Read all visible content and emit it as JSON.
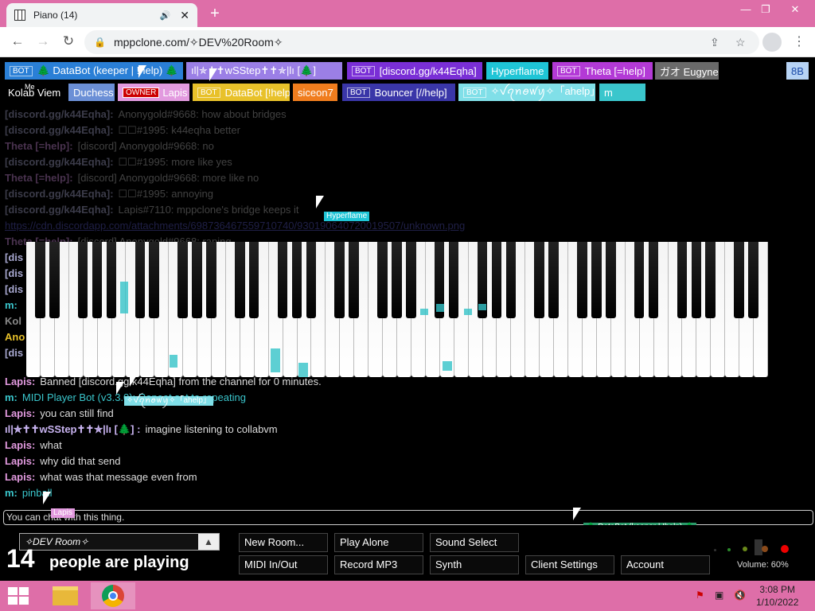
{
  "browser": {
    "tab_title": "Piano (14)",
    "url": "mppclone.com/✧DEV%20Room✧",
    "new_tab": "+",
    "win_min": "—",
    "win_max": "❐",
    "win_close": "✕"
  },
  "users_row1": [
    {
      "bot": "BOT",
      "name": "🌲 DataBot (keeper | !help) 🌲",
      "color": "#2a7fd6"
    },
    {
      "bot": "",
      "name": "ıl|✯✝✝wSStep✝✝✯|lı [🌲]",
      "color": "#9b7fe6"
    },
    {
      "bot": "BOT",
      "name": "[discord.gg/k44Eqha]",
      "color": "#7a2fd6"
    },
    {
      "bot": "",
      "name": "Hyperflame",
      "color": "#1fc5d6"
    },
    {
      "bot": "BOT",
      "name": "Theta [=help]",
      "color": "#b33ad6"
    },
    {
      "bot": "",
      "name": "ガオ Eugyne",
      "color": "#6a6a6a"
    },
    {
      "bot": "",
      "name": "8B",
      "color": "#b7d3f5"
    }
  ],
  "users_row2": [
    {
      "bot": "",
      "name": "Kolab Viem",
      "color": "#000000"
    },
    {
      "bot": "",
      "name": "Duchess",
      "color": "#6b8fd6"
    },
    {
      "bot": "OWNER",
      "name": "Lapis",
      "color": "#e29adf"
    },
    {
      "bot": "BOT",
      "name": "DataBot [!help]",
      "color": "#e8c12a"
    },
    {
      "bot": "",
      "name": "siceon7",
      "color": "#f07d1e"
    },
    {
      "bot": "BOT",
      "name": "Bouncer [//help]",
      "color": "#3a36a8"
    },
    {
      "bot": "BOT",
      "name": "✧ꪜꪖꪀꪮꪝꪗ✧「ahelp」",
      "color": "#80dfe8"
    },
    {
      "bot": "",
      "name": "m",
      "color": "#3ac6cc"
    }
  ],
  "me_label": "Me",
  "chat": [
    {
      "name": "[discord.gg/k44Eqha]:",
      "text": "Anonygold#9668: how about bridges",
      "color": "#a8a8d0",
      "dim": true
    },
    {
      "name": "[discord.gg/k44Eqha]:",
      "text": "☐☐#1995: k44eqha better",
      "color": "#a8a8d0",
      "dim": true
    },
    {
      "name": "Theta [=help]:",
      "text": "[discord] Anonygold#9668: no",
      "color": "#d090e0",
      "dim": true
    },
    {
      "name": "[discord.gg/k44Eqha]:",
      "text": "☐☐#1995: more like yes",
      "color": "#a8a8d0",
      "dim": true
    },
    {
      "name": "Theta [=help]:",
      "text": "[discord] Anonygold#9668: more like no",
      "color": "#d090e0",
      "dim": true
    },
    {
      "name": "[discord.gg/k44Eqha]:",
      "text": "☐☐#1995: annoying",
      "color": "#a8a8d0",
      "dim": true
    },
    {
      "name": "[discord.gg/k44Eqha]:",
      "text": "Lapis#7110: mppclone's bridge keeps it",
      "color": "#a8a8d0",
      "dim": true
    },
    {
      "name": "",
      "text": "https://cdn.discordapp.com/attachments/698736467559710740/930190640720019507/unknown.png",
      "color": "#5a5ac8",
      "dim": true,
      "link": true
    },
    {
      "name": "Theta [=help]:",
      "text": "[discord] Anonygold#9668: raping",
      "color": "#d090e0",
      "dim": true
    }
  ],
  "chat_partial": [
    {
      "name": "[dis",
      "color": "#a8a8d0"
    },
    {
      "name": "[dis",
      "color": "#a8a8d0"
    },
    {
      "name": "[dis",
      "color": "#a8a8d0"
    },
    {
      "name": "m:",
      "color": "#3ac6cc"
    },
    {
      "name": "Kol",
      "color": "#888888"
    },
    {
      "name": "Ano",
      "color": "#e8c12a"
    },
    {
      "name": "[dis",
      "color": "#a8a8d0"
    }
  ],
  "chat_bottom": [
    {
      "name": "Lapis:",
      "text": "Banned [discord.gg/k44Eqha] from the channel for 0 minutes.",
      "color": "#e29adf"
    },
    {
      "name": "m:",
      "text": "MIDI Player Bot (v3.3.0): Repeat set to repeating",
      "color": "#3ac6cc"
    },
    {
      "name": "Lapis:",
      "text": "you can still find",
      "color": "#e29adf"
    },
    {
      "name": "ıl|✯✝✝wSStep✝✝✯|lı [🌲] :",
      "text": "imagine listening to collabvm",
      "color": "#c8b3f0"
    },
    {
      "name": "Lapis:",
      "text": "what",
      "color": "#e29adf"
    },
    {
      "name": "Lapis:",
      "text": "why did that send",
      "color": "#e29adf"
    },
    {
      "name": "Lapis:",
      "text": "what was that message even from",
      "color": "#e29adf"
    },
    {
      "name": "m:",
      "text": "pinball",
      "color": "#3ac6cc"
    }
  ],
  "chat_input_placeholder": "You can chat with this thing.",
  "cursor_tags": [
    {
      "label": "Hyperflame",
      "color": "#1fc5d6"
    },
    {
      "label": "✧ꪜꪖꪀꪮꪝꪗ✧「ahelp」",
      "color": "#80dfe8"
    },
    {
      "label": "Lapis",
      "color": "#e29adf"
    },
    {
      "label": "🌲 DataBot (keeper | !help) 🌲",
      "color": "#2a9a6a"
    },
    {
      "label": "Oty「ahelp」",
      "color": "#e8c12a"
    }
  ],
  "room": {
    "name": "✧DEV Room✧",
    "up": "▲"
  },
  "count": "14",
  "count_label": "people are playing",
  "buttons": [
    {
      "label": "New Room..."
    },
    {
      "label": "Play Alone"
    },
    {
      "label": "Sound Select"
    },
    {
      "label": "MIDI In/Out"
    },
    {
      "label": "Record MP3"
    },
    {
      "label": "Synth"
    },
    {
      "label": "Client Settings"
    },
    {
      "label": "Account"
    }
  ],
  "volume": "Volume: 60%",
  "taskbar": {
    "time": "3:08 PM",
    "date": "1/10/2022"
  },
  "accent_color": "#de6ea8"
}
